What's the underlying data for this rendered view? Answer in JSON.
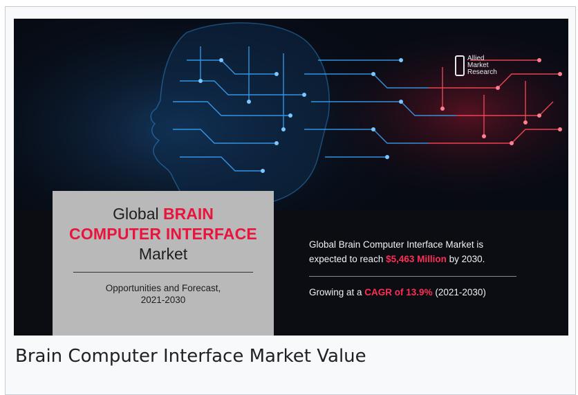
{
  "figure": {
    "caption": "Brain Computer Interface Market Value"
  },
  "banner": {
    "logo": {
      "lines": [
        "Allied",
        "Market",
        "Research"
      ]
    },
    "title": {
      "line1_prefix": "Global ",
      "line1_highlight": "BRAIN",
      "line2": "COMPUTER INTERFACE",
      "line3": "Market",
      "subtitle_line1": "Opportunities and Forecast,",
      "subtitle_line2": "2021-2030"
    },
    "stats": {
      "line1": "Global Brain Computer Interface Market is",
      "line2_prefix": "expected to reach ",
      "value": "$5,463 Million",
      "line2_suffix": " by 2030.",
      "growth_prefix": "Growing at a ",
      "cagr": "CAGR of 13.9%",
      "growth_suffix": " (2021-2030)"
    },
    "colors": {
      "accent": "#e8143c",
      "circuit_blue": "#3aa8ff",
      "circuit_red": "#ff4a5a",
      "background": "#070b14"
    }
  }
}
